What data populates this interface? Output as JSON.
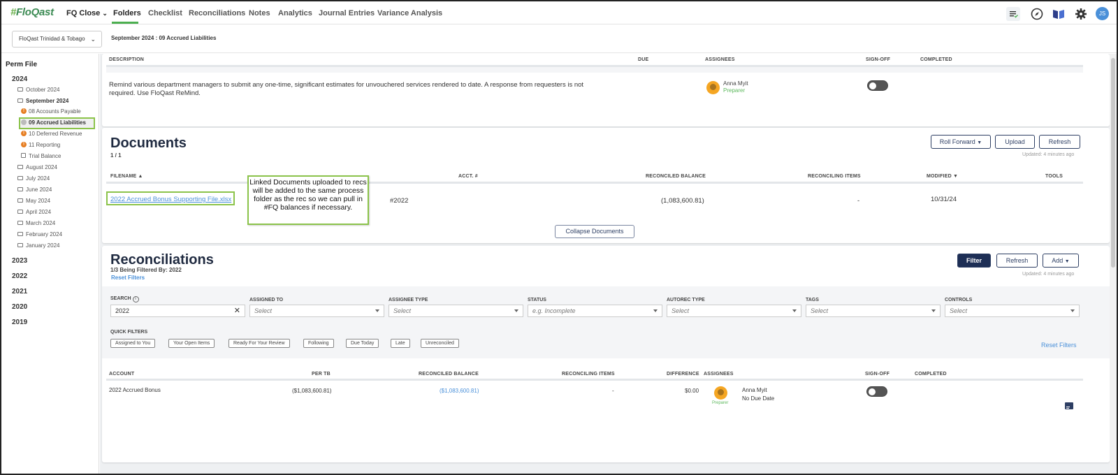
{
  "nav": {
    "logo": "FloQast",
    "close_menu": "FQ Close",
    "items": [
      "Folders",
      "Checklist",
      "Reconciliations",
      "Notes",
      "Analytics",
      "Journal Entries",
      "Variance Analysis"
    ],
    "user_initials": "JS"
  },
  "subheader": {
    "entity": "FloQast Trinidad & Tobago",
    "breadcrumb": "September 2024 : 09 Accrued Liabilities"
  },
  "sidebar": {
    "root": "Perm File",
    "year_2024": "2024",
    "months_top": [
      "October 2024",
      "September 2024"
    ],
    "sept_children": [
      "08 Accounts Payable",
      "09 Accrued Liabilities",
      "10 Deferred Revenue",
      "11 Reporting",
      "Trial Balance"
    ],
    "months_bottom": [
      "August 2024",
      "July 2024",
      "June 2024",
      "May 2024",
      "April 2024",
      "March 2024",
      "February 2024",
      "January 2024"
    ],
    "years": [
      "2023",
      "2022",
      "2021",
      "2020",
      "2019"
    ]
  },
  "checklist": {
    "headers": {
      "description": "DESCRIPTION",
      "due": "DUE",
      "assignees": "ASSIGNEES",
      "signoff": "SIGN-OFF",
      "completed": "COMPLETED"
    },
    "row_text": "Remind various department managers to submit any one-time, significant estimates for unvouchered services rendered to date. A response from requesters is not required. Use FloQast ReMind.",
    "assignee_name": "Anna Myit",
    "assignee_role": "Preparer"
  },
  "documents": {
    "title": "Documents",
    "count": "1 / 1",
    "roll_forward": "Roll Forward",
    "upload": "Upload",
    "refresh": "Refresh",
    "updated": "Updated: 4 minutes ago",
    "headers": {
      "filename": "FILENAME",
      "acct": "ACCT. #",
      "balance": "RECONCILED BALANCE",
      "items": "RECONCILING ITEMS",
      "modified": "MODIFIED",
      "tools": "TOOLS"
    },
    "row": {
      "filename": "2022 Accrued Bonus Supporting File.xlsx",
      "acct": "#2022",
      "balance": "(1,083,600.81)",
      "items": "-",
      "modified": "10/31/24"
    },
    "collapse": "Collapse Documents",
    "callout": "Linked Documents uploaded to recs will be added to the same process folder as the rec so we can pull in #FQ balances if necessary."
  },
  "reconciliations": {
    "title": "Reconciliations",
    "filtered": "1/3 Being Filtered By: 2022",
    "reset_filters": "Reset Filters",
    "filter_btn": "Filter",
    "refresh": "Refresh",
    "add": "Add",
    "updated": "Updated: 4 minutes ago",
    "filters": {
      "search_label": "SEARCH",
      "search_value": "2022",
      "assigned_to": "ASSIGNED TO",
      "assignee_type": "ASSIGNEE TYPE",
      "status": "STATUS",
      "autorec": "AUTOREC TYPE",
      "tags": "TAGS",
      "controls": "CONTROLS",
      "select": "Select",
      "status_placeholder": "e.g. Incomplete"
    },
    "quick_filters_label": "QUICK FILTERS",
    "quick_filters": [
      "Assigned to You",
      "Your Open Items",
      "Ready For Your Review",
      "Following",
      "Due Today",
      "Late",
      "Unreconciled"
    ],
    "reset_filters_right": "Reset Filters",
    "headers": {
      "account": "ACCOUNT",
      "per_tb": "PER TB",
      "balance": "RECONCILED BALANCE",
      "items": "RECONCILING ITEMS",
      "difference": "DIFFERENCE",
      "assignees": "ASSIGNEES",
      "signoff": "SIGN-OFF",
      "completed": "COMPLETED"
    },
    "row": {
      "account": "2022 Accrued Bonus",
      "per_tb": "($1,083,600.81)",
      "balance": "($1,083,600.81)",
      "items": "-",
      "difference": "$0.00",
      "assignee_name": "Anna Myit",
      "due": "No Due Date",
      "role": "Preparer"
    }
  },
  "colors": {
    "accent_green": "#4caf50",
    "highlight_green": "#8bc34a",
    "navy": "#1d2e55",
    "link": "#4a90d9",
    "warning": "#e67e22"
  }
}
